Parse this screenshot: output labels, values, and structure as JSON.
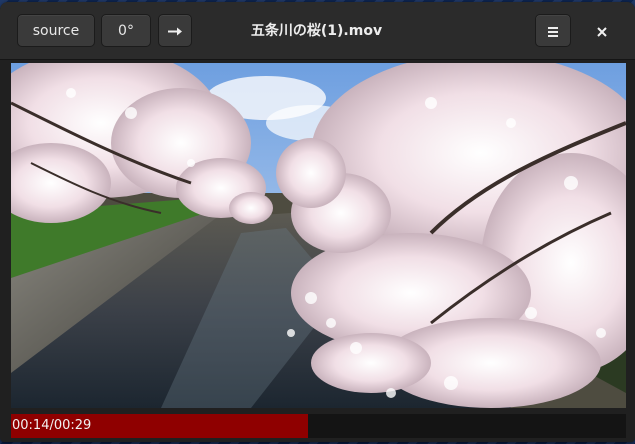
{
  "window": {
    "title": "五条川の桜(1).mov"
  },
  "headerbar": {
    "source_label": "source",
    "rotation_label": "0°",
    "arrow_icon": "arrow-right-icon",
    "menu_icon": "hamburger-menu-icon",
    "close_icon": "close-icon"
  },
  "video": {
    "description_icon": "video-frame"
  },
  "playback": {
    "timecode": "00:14/00:29",
    "progress_fraction": 0.4828,
    "fill_color": "#8f0000"
  }
}
